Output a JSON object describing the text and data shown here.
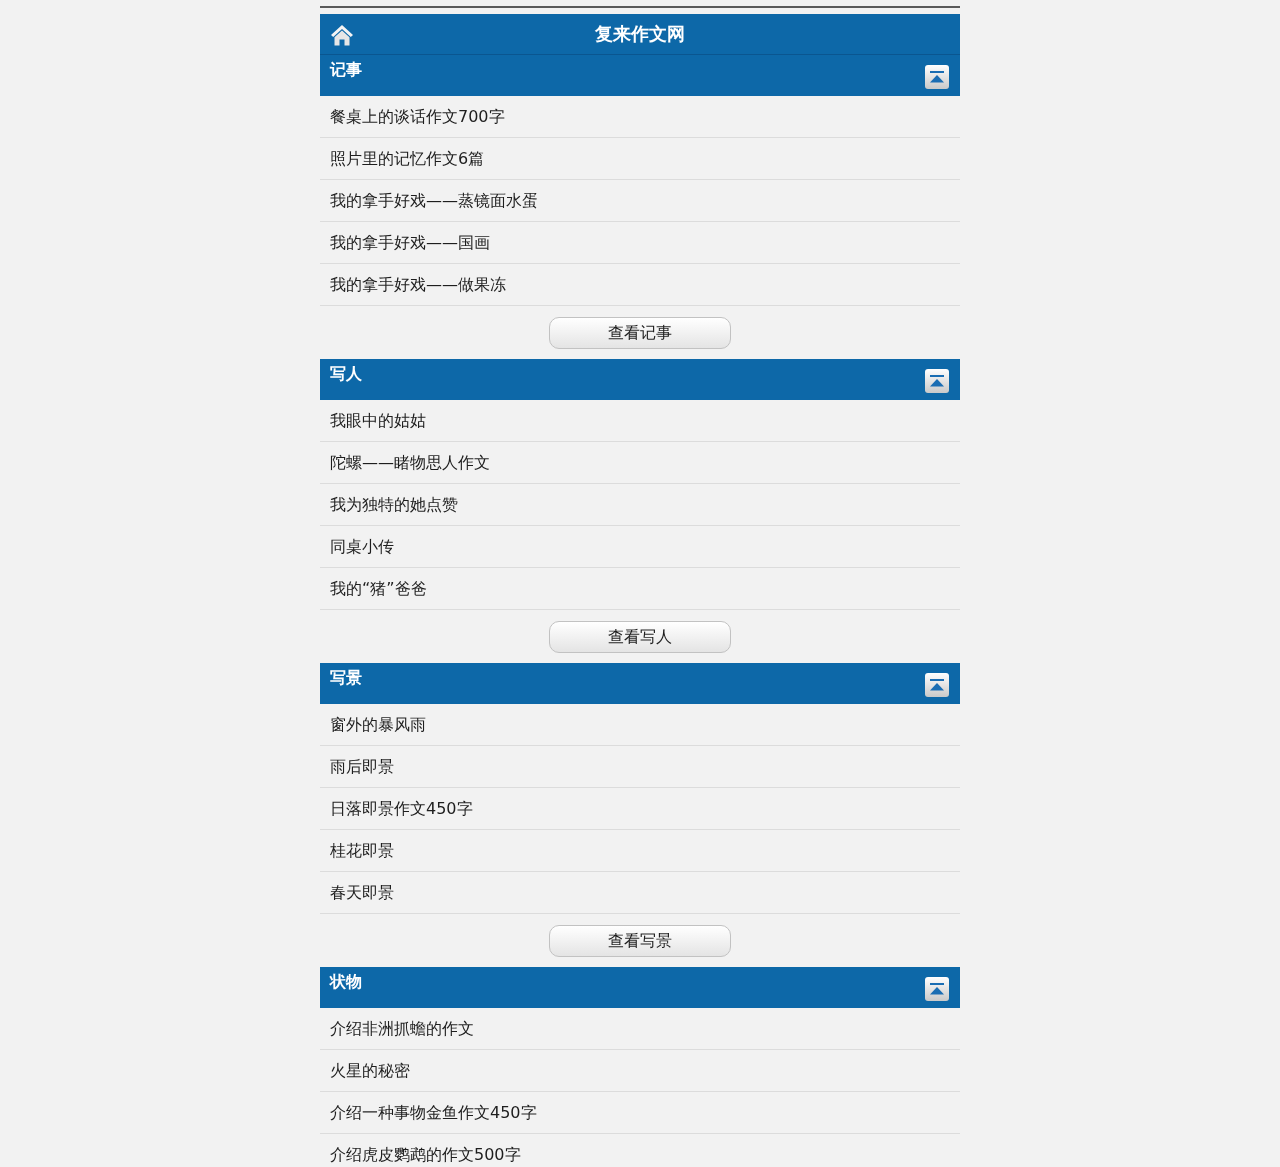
{
  "header": {
    "title": "复来作文网"
  },
  "sections": [
    {
      "title": "记事",
      "items": [
        "餐桌上的谈话作文700字",
        "照片里的记忆作文6篇",
        "我的拿手好戏——蒸镜面水蛋",
        "我的拿手好戏——国画",
        "我的拿手好戏——做果冻"
      ],
      "more_button": "查看记事"
    },
    {
      "title": "写人",
      "items": [
        "我眼中的姑姑",
        "陀螺——睹物思人作文",
        "我为独特的她点赞",
        "同桌小传",
        "我的“猪”爸爸"
      ],
      "more_button": "查看写人"
    },
    {
      "title": "写景",
      "items": [
        "窗外的暴风雨",
        "雨后即景",
        "日落即景作文450字",
        "桂花即景",
        "春天即景"
      ],
      "more_button": "查看写景"
    },
    {
      "title": "状物",
      "items": [
        "介绍非洲抓蟾的作文",
        "火星的秘密",
        "介绍一种事物金鱼作文450字",
        "介绍虎皮鹦鹉的作文500字"
      ]
    }
  ]
}
